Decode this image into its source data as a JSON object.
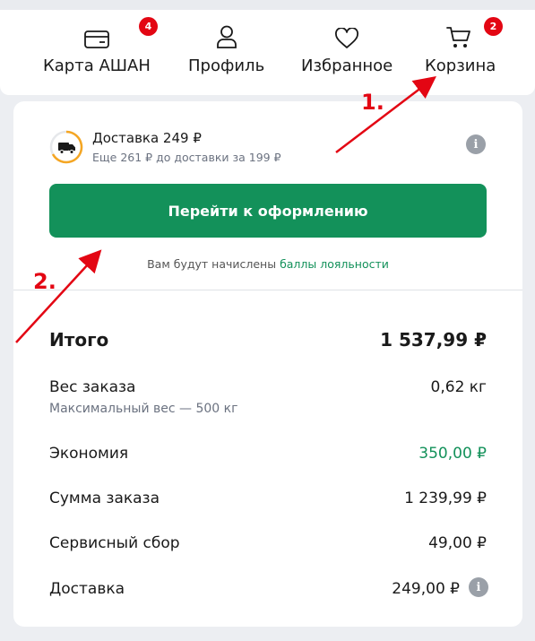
{
  "nav": {
    "items": [
      {
        "label": "Карта АШАН",
        "badge": "4"
      },
      {
        "label": "Профиль"
      },
      {
        "label": "Избранное"
      },
      {
        "label": "Корзина",
        "badge": "2"
      }
    ]
  },
  "delivery": {
    "title": "Доставка 249 ₽",
    "subtitle": "Еще 261 ₽ до доставки за 199 ₽"
  },
  "checkout_button": "Перейти к оформлению",
  "loyalty": {
    "prefix": "Вам будут начислены ",
    "link": "баллы лояльности"
  },
  "summary": {
    "total_label": "Итого",
    "total_value": "1 537,99 ₽",
    "weight_label": "Вес заказа",
    "weight_value": "0,62 кг",
    "weight_note": "Максимальный вес — 500 кг",
    "savings_label": "Экономия",
    "savings_value": "350,00 ₽",
    "order_sum_label": "Сумма заказа",
    "order_sum_value": "1 239,99 ₽",
    "service_label": "Сервисный сбор",
    "service_value": "49,00 ₽",
    "delivery_label": "Доставка",
    "delivery_value": "249,00 ₽"
  },
  "annotations": {
    "one": "1.",
    "two": "2."
  },
  "colors": {
    "accent_green": "#13915a",
    "badge_red": "#e30613",
    "annotation_red": "#e30613"
  },
  "icons": {
    "card": "card-icon",
    "profile": "profile-icon",
    "favorites": "heart-icon",
    "cart": "cart-icon",
    "delivery": "truck-icon",
    "info": "info-icon"
  }
}
